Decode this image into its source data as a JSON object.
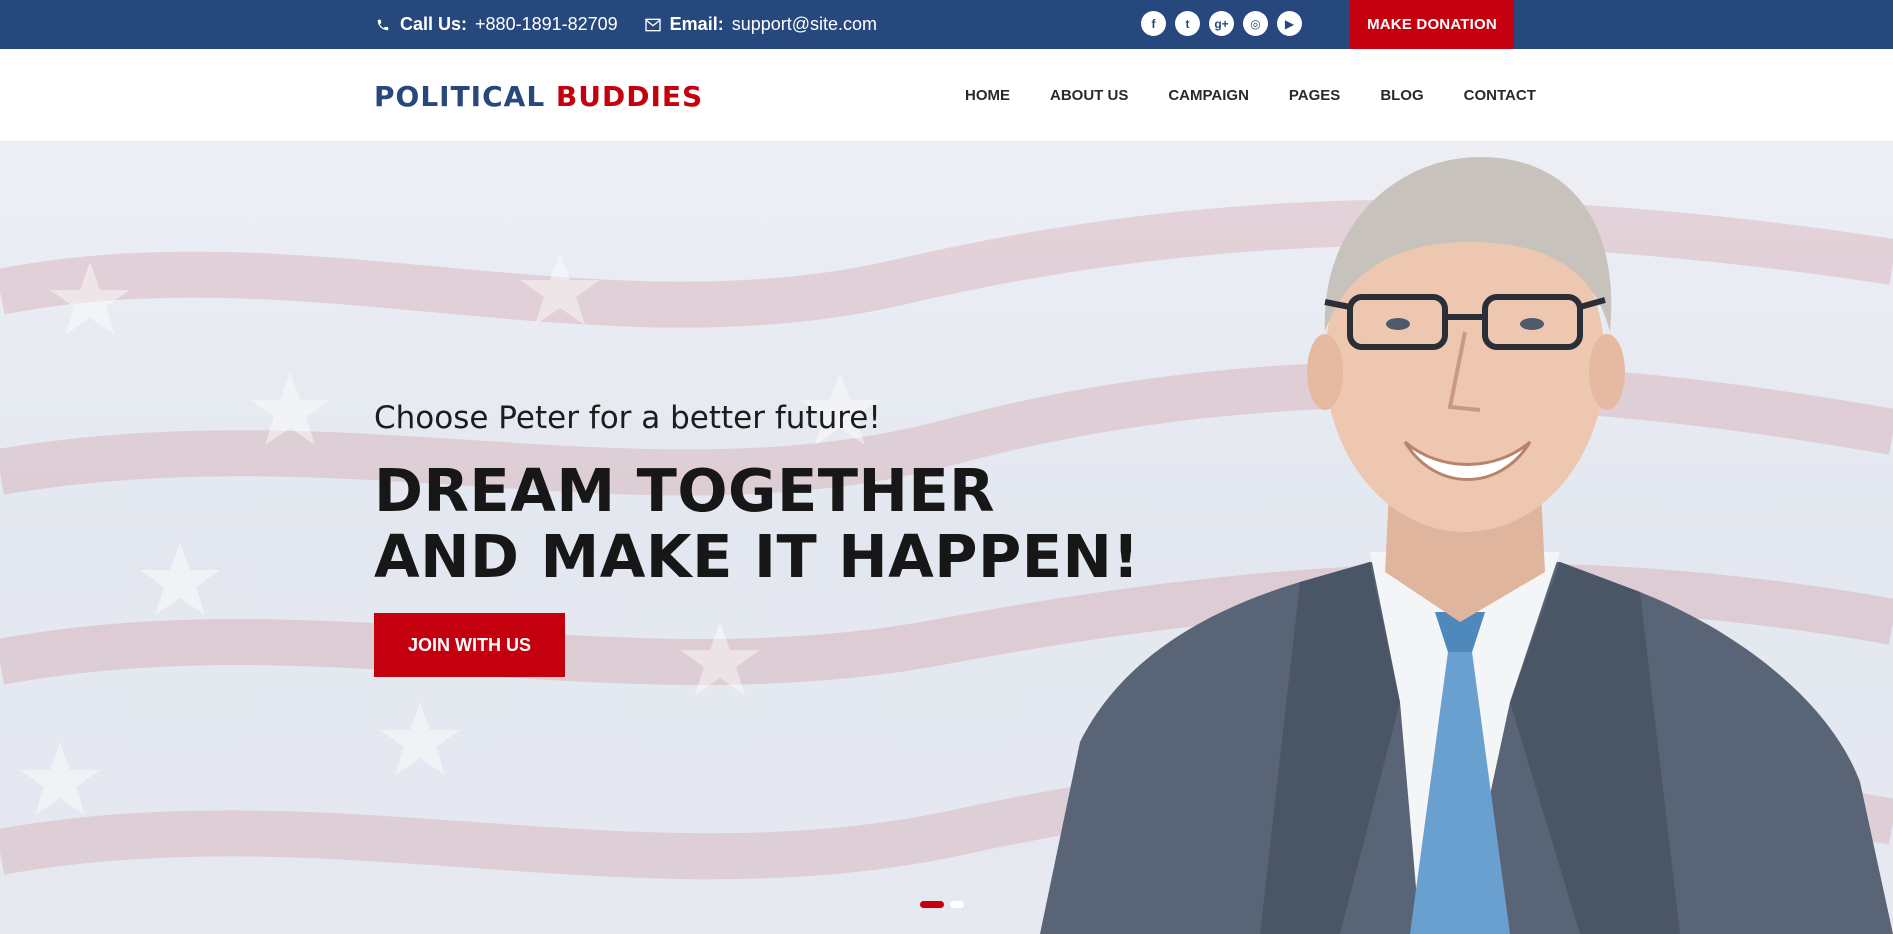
{
  "topbar": {
    "phone_label": "Call Us:",
    "phone_value": "+880-1891-82709",
    "email_label": "Email:",
    "email_value": "support@site.com",
    "social_icons": [
      "facebook-icon",
      "twitter-icon",
      "google-plus-icon",
      "instagram-icon",
      "youtube-icon"
    ],
    "social_glyphs": [
      "f",
      "t",
      "g+",
      "◎",
      "▶"
    ],
    "donate_label": "MAKE DONATION"
  },
  "header": {
    "logo_part1": "POLITICAL",
    "logo_part2": "BUDDIES",
    "nav": [
      "HOME",
      "ABOUT US",
      "CAMPAIGN",
      "PAGES",
      "BLOG",
      "CONTACT"
    ]
  },
  "hero": {
    "tagline": "Choose Peter for a better future!",
    "headline_line1": "DREAM TOGETHER",
    "headline_line2": "AND MAKE IT HAPPEN!",
    "cta_label": "JOIN WITH US",
    "slides_total": 2,
    "active_slide": 1
  },
  "colors": {
    "brand_blue": "#26487c",
    "brand_red": "#c4000f",
    "text_dark": "#171717"
  }
}
